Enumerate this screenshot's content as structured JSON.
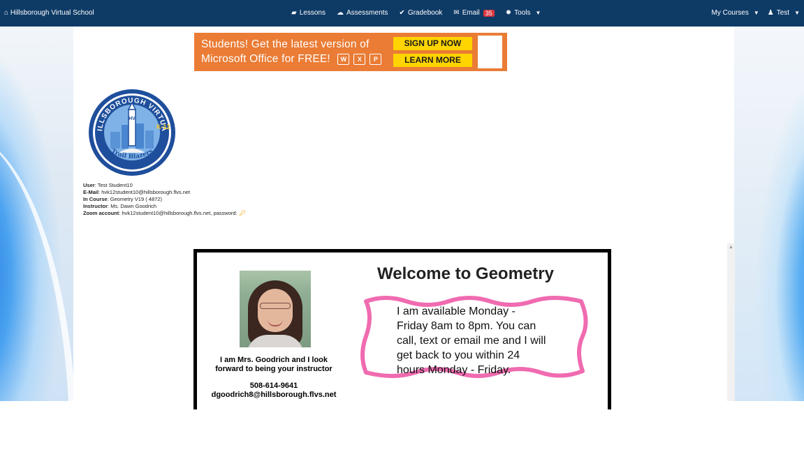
{
  "nav": {
    "brand": "Hillsborough Virtual School",
    "items": [
      {
        "label": "Lessons",
        "icon": "book-icon"
      },
      {
        "label": "Assessments",
        "icon": "cloud-icon"
      },
      {
        "label": "Gradebook",
        "icon": "check-icon"
      },
      {
        "label": "Email",
        "icon": "envelope-icon",
        "badge": "35"
      },
      {
        "label": "Tools",
        "icon": "gear-icon"
      }
    ],
    "my_courses": "My Courses",
    "user": "Test"
  },
  "banner": {
    "line1": "Students! Get the latest version of",
    "line2": "Microsoft Office for FREE!",
    "signup": "SIGN UP NOW",
    "learn_more": "LEARN MORE",
    "app_icons": [
      "W",
      "X",
      "P"
    ]
  },
  "logo": {
    "top_text": "HILLSBOROUGH VIRTUAL",
    "grade_text": "K-12",
    "monogram": "HV",
    "bottom_text": "Trail Blazers"
  },
  "user_info": {
    "user_label": "User",
    "user_value": "Test Student10",
    "email_label": "E-Mail",
    "email_value": "hvk12student10@hillsborough.flvs.net",
    "course_label": "In Course",
    "course_value": "Geometry V19 ( 4872)",
    "instructor_label": "Instructor",
    "instructor_value": "Ms. Dawn Goodrich",
    "zoom_label": "Zoom account",
    "zoom_value": "hvk12student10@hillsborough.flvs.net, password:"
  },
  "content": {
    "welcome": "Welcome to Geometry",
    "teacher_line1": "I am Mrs. Goodrich and I look",
    "teacher_line2": "forward to being your instructor",
    "phone": "508-614-9641",
    "email": "dgoodrich8@hillsborough.flvs.net",
    "availability": [
      "I am available Monday -",
      "Friday 8am to 8pm.  You can",
      "call, text or email me and I will",
      "get back to you within 24",
      "hours Monday - Friday."
    ]
  },
  "colors": {
    "navbar": "#0e3a66",
    "banner": "#ea7c35",
    "banner_button": "#ffd400",
    "badge": "#d9363e",
    "frame_wave": "#f06bb0"
  }
}
